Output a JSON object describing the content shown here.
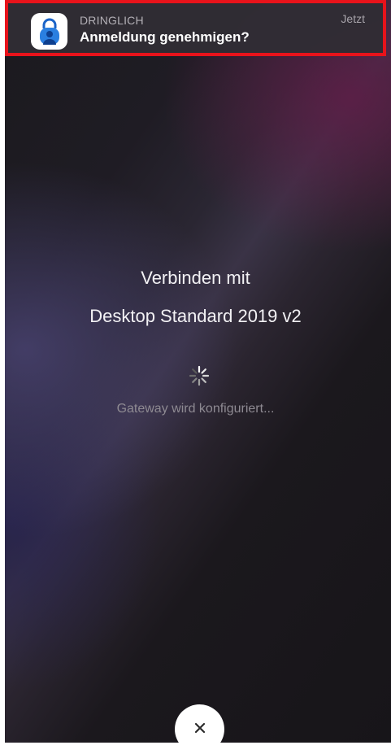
{
  "notification": {
    "app_icon": "authenticator-lock-icon",
    "category": "DRINGLICH",
    "title": "Anmeldung genehmigen?",
    "time": "Jetzt",
    "highlight_color": "#e8131b"
  },
  "connection": {
    "label": "Verbinden mit",
    "target": "Desktop Standard 2019 v2",
    "spinner_icon": "loading-spinner-icon",
    "status": "Gateway wird konfiguriert..."
  },
  "close_button": {
    "icon": "close-icon"
  }
}
